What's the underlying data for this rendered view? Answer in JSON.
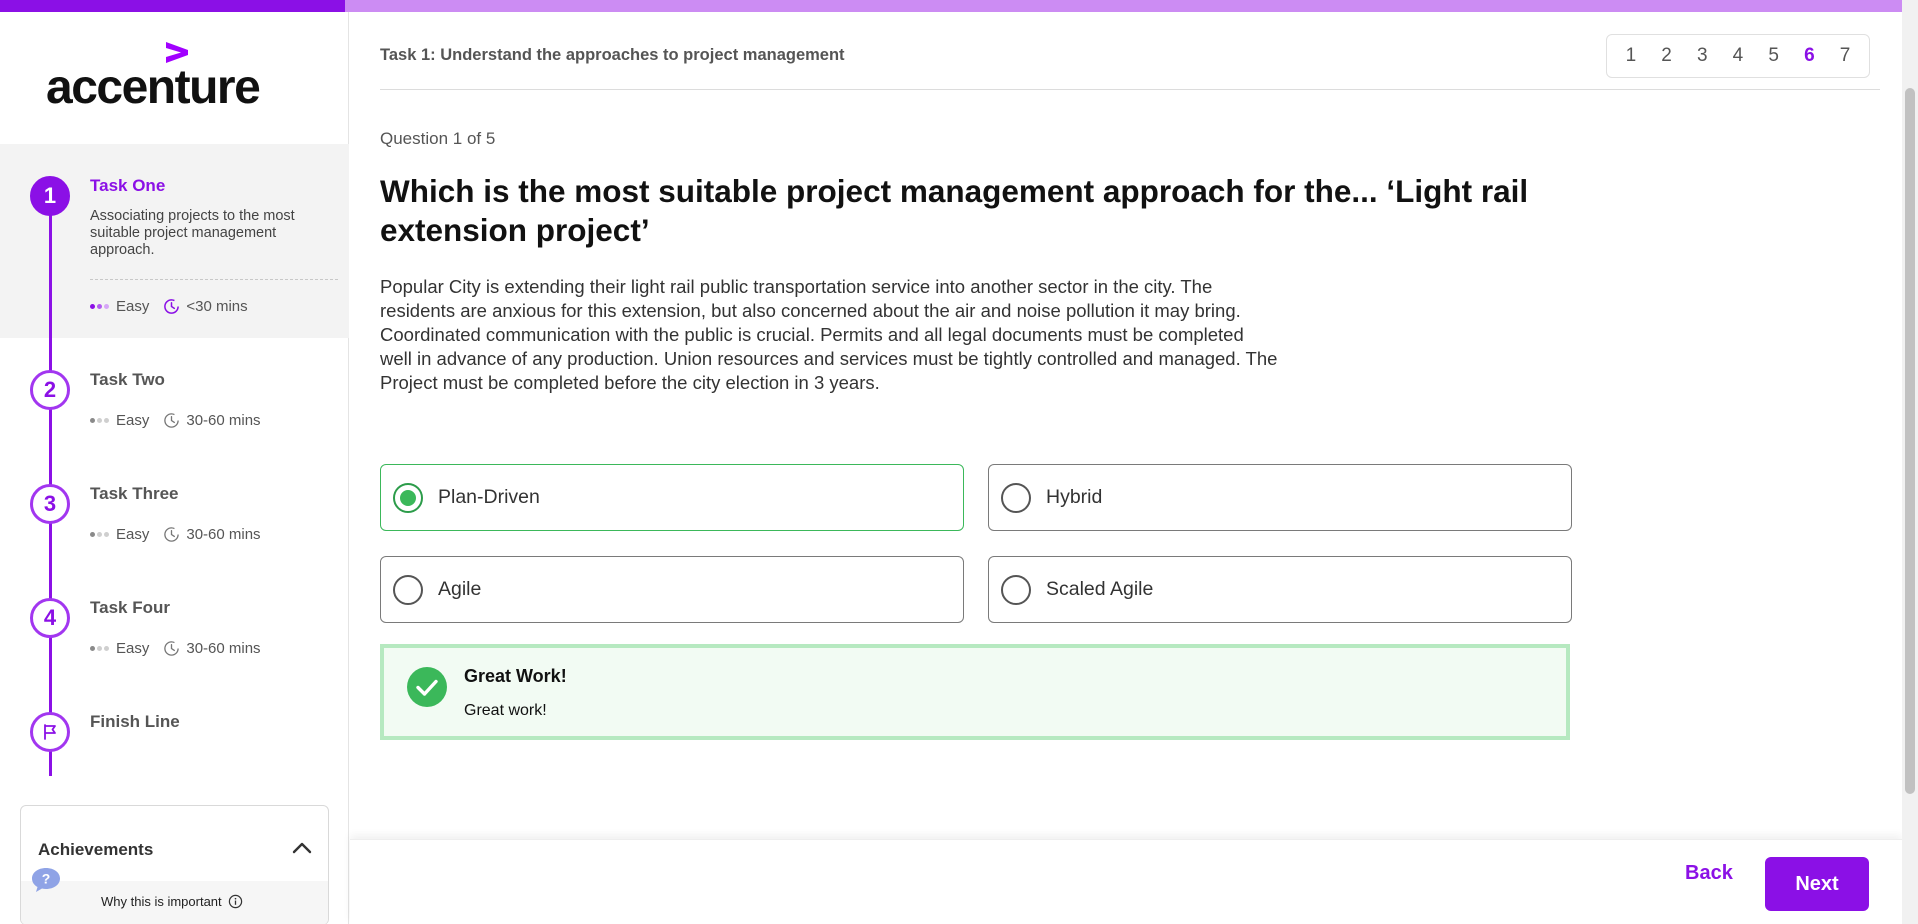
{
  "progress": {
    "fraction": 0.18
  },
  "brand": {
    "logo_text": "accenture",
    "accent": "#8b10e6",
    "success": "#3bb85a"
  },
  "sidebar": {
    "tasks": [
      {
        "number": "1",
        "title": "Task One",
        "description": "Associating projects to the most suitable project management approach.",
        "difficulty": "Easy",
        "duration": "<30 mins",
        "state": "active"
      },
      {
        "number": "2",
        "title": "Task Two",
        "difficulty": "Easy",
        "duration": "30-60 mins",
        "state": "upcoming"
      },
      {
        "number": "3",
        "title": "Task Three",
        "difficulty": "Easy",
        "duration": "30-60 mins",
        "state": "upcoming"
      },
      {
        "number": "4",
        "title": "Task Four",
        "difficulty": "Easy",
        "duration": "30-60 mins",
        "state": "upcoming"
      },
      {
        "title": "Finish Line",
        "icon": "flag-icon",
        "state": "upcoming"
      }
    ],
    "achievements": {
      "title": "Achievements",
      "why_label": "Why this is important"
    }
  },
  "header": {
    "breadcrumb": "Task 1: Understand the approaches to project management",
    "pages": [
      "1",
      "2",
      "3",
      "4",
      "5",
      "6",
      "7"
    ],
    "current_page": "6"
  },
  "question": {
    "counter": "Question 1 of 5",
    "title": "Which is the most suitable project management approach for the... ‘Light rail extension project’",
    "body": "Popular City is extending their light rail public transportation service into another sector in the city. The residents are anxious for this extension, but also concerned about the air and noise pollution it may bring. Coordinated communication with the public is crucial. Permits and all legal documents must be completed well in advance of any production. Union resources and services must be tightly controlled and managed. The Project must be completed before the city election in 3 years.",
    "options": [
      {
        "label": "Plan-Driven",
        "selected": true
      },
      {
        "label": "Hybrid",
        "selected": false
      },
      {
        "label": "Agile",
        "selected": false
      },
      {
        "label": "Scaled Agile",
        "selected": false
      }
    ]
  },
  "feedback": {
    "title": "Great Work!",
    "message": "Great work!"
  },
  "footer": {
    "back_label": "Back",
    "next_label": "Next"
  }
}
